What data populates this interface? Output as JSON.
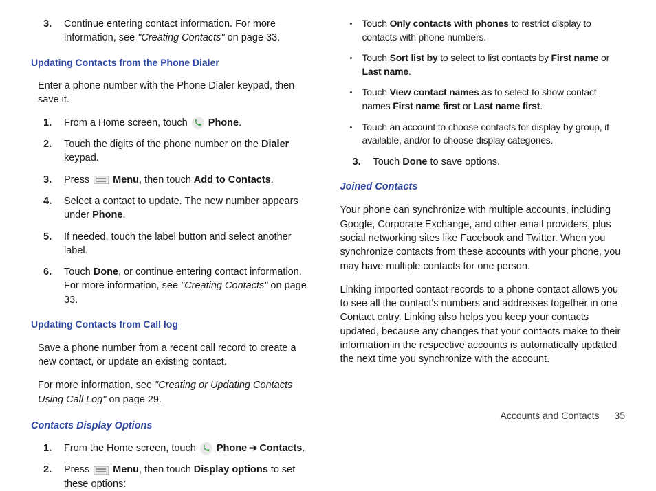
{
  "left": {
    "step3_a": "Continue entering contact information. For more information, see ",
    "step3_b": "\"Creating Contacts\"",
    "step3_c": " on page 33.",
    "h1": "Updating Contacts from the Phone Dialer",
    "p1": "Enter a phone number with the Phone Dialer keypad, then save it.",
    "s1_a": "From a Home screen, touch ",
    "s1_b": "Phone",
    "s1_c": ".",
    "s2_a": "Touch the digits of the phone number on the ",
    "s2_b": "Dialer",
    "s2_c": " keypad.",
    "s3_a": "Press ",
    "s3_b": "Menu",
    "s3_c": ", then touch ",
    "s3_d": "Add to Contacts",
    "s3_e": ".",
    "s4_a": "Select a contact to update. The new number appears under ",
    "s4_b": "Phone",
    "s4_c": ".",
    "s5": "If needed, touch the label button and select another label.",
    "s6_a": "Touch ",
    "s6_b": "Done",
    "s6_c": ", or continue entering contact information. For more information, see ",
    "s6_d": "\"Creating Contacts\"",
    "s6_e": " on page 33.",
    "h2": "Updating Contacts from Call log",
    "p2": "Save a phone number from a recent call record to create a new contact, or update an existing contact.",
    "p3_a": "For more information, see ",
    "p3_b": "\"Creating or Updating Contacts Using Call Log\"",
    "p3_c": " on page 29.",
    "h3": "Contacts Display Options",
    "cdo1_a": "From the Home screen, touch ",
    "cdo1_b": "Phone",
    "cdo1_c": "Contacts",
    "cdo1_d": ".",
    "cdo2_a": "Press ",
    "cdo2_b": "Menu",
    "cdo2_c": ", then touch ",
    "cdo2_d": "Display options",
    "cdo2_e": " to set these options:"
  },
  "right": {
    "b1_a": "Touch ",
    "b1_b": "Only contacts with phones",
    "b1_c": " to restrict display to contacts with phone numbers.",
    "b2_a": "Touch ",
    "b2_b": "Sort list by",
    "b2_c": " to select to list contacts by ",
    "b2_d": "First name",
    "b2_e": " or ",
    "b2_f": "Last name",
    "b2_g": ".",
    "b3_a": "Touch ",
    "b3_b": "View contact names as",
    "b3_c": " to select to show contact names ",
    "b3_d": "First name first",
    "b3_e": " or ",
    "b3_f": "Last name first",
    "b3_g": ".",
    "b4": "Touch an account to choose contacts for display by group, if available, and/or to choose display categories.",
    "s3_a": "Touch ",
    "s3_b": "Done",
    "s3_c": " to save options.",
    "h1": "Joined Contacts",
    "p1": "Your phone can synchronize with multiple accounts, including Google, Corporate Exchange, and other email providers, plus social networking sites like Facebook and Twitter. When you synchronize contacts from these accounts with your phone, you may have multiple contacts for one person.",
    "p2": "Linking imported contact records to a phone contact allows you to see all the contact's numbers and addresses together in one Contact entry. Linking also helps you keep your contacts updated, because any changes that your contacts make to their information in the respective accounts is automatically updated the next time you synchronize with the account."
  },
  "footer": {
    "label": "Accounts and Contacts",
    "page": "35"
  },
  "nums": {
    "n1": "1.",
    "n2": "2.",
    "n3": "3.",
    "n4": "4.",
    "n5": "5.",
    "n6": "6."
  },
  "arrow": "➔"
}
